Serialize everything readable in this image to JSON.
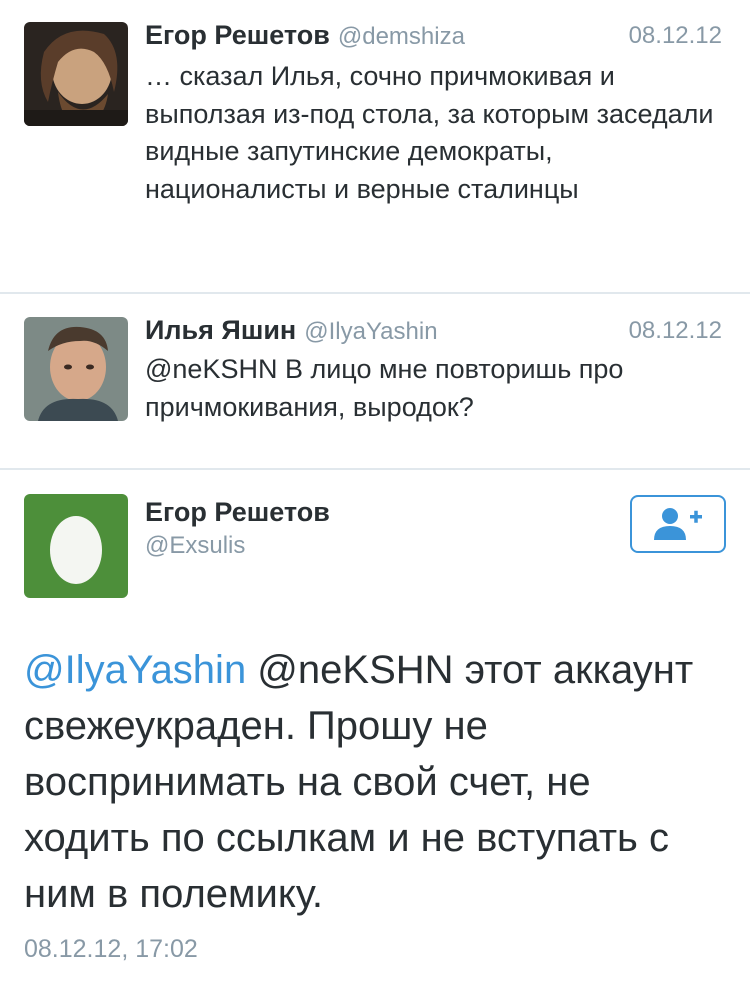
{
  "tweets": [
    {
      "name": "Егор Решетов",
      "handle": "@demshiza",
      "date": "08.12.12",
      "text": "… сказал Илья, сочно причмокивая и выползая из-под стола, за которым заседали видные запутинские демократы, националисты и верные сталинцы"
    },
    {
      "name": "Илья Яшин",
      "handle": "@IlyaYashin",
      "date": "08.12.12",
      "text": "@neKSHN В лицо мне повторишь про причмокивания, выродок?"
    }
  ],
  "main_tweet": {
    "name": "Егор Решетов",
    "handle": "@Exsulis",
    "mention": "@IlyaYashin",
    "text_rest": " @neKSHN этот аккаунт свежеукраден. Прошу не воспринимать на свой счет, не ходить по ссылкам и не вступать с ним в полемику.",
    "timestamp": "08.12.12, 17:02",
    "follow_icon": "add-user-icon"
  },
  "colors": {
    "link": "#3b94d9",
    "meta": "#8899a6",
    "text": "#292f33",
    "egg_bg": "#4d8f3a"
  }
}
